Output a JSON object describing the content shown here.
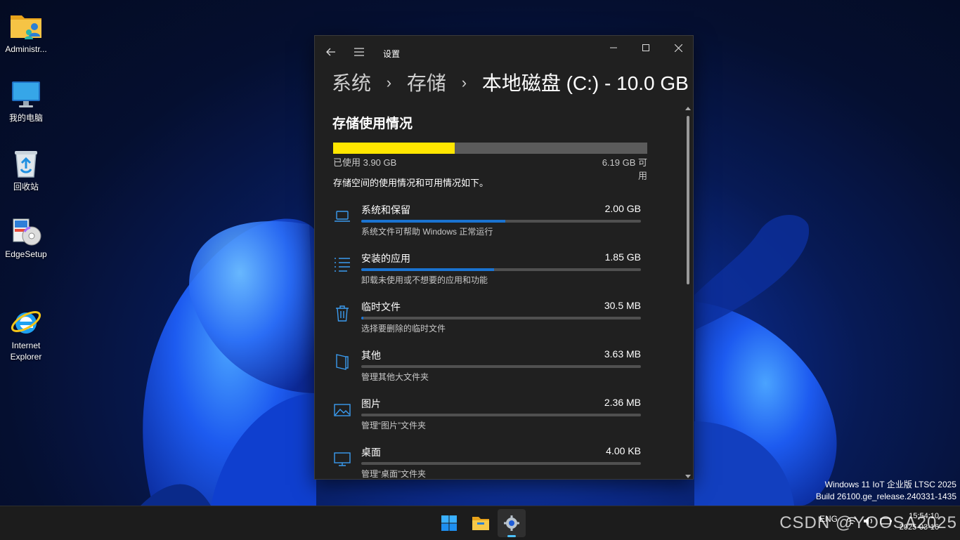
{
  "desktop": {
    "icons": [
      {
        "label": "Administr...",
        "icon": "user-folder-icon"
      },
      {
        "label": "我的电脑",
        "icon": "computer-icon"
      },
      {
        "label": "回收站",
        "icon": "recycle-bin-icon"
      },
      {
        "label": "EdgeSetup",
        "icon": "installer-icon"
      },
      {
        "label": "Internet\nExplorer",
        "icon": "internet-explorer-icon"
      }
    ]
  },
  "window": {
    "app_title": "设置",
    "breadcrumb": {
      "level1": "系统",
      "separator": "›",
      "level2": "存储",
      "current": "本地磁盘 (C:) - 10.0 GB"
    },
    "section_title": "存储使用情况",
    "usage": {
      "used_label": "已使用 3.90 GB",
      "free_label": "6.19 GB 可用",
      "used_fraction": 0.387,
      "bar_color": "#ffe600"
    },
    "description": "存储空间的使用情况和可用情况如下。",
    "categories": [
      {
        "name": "系统和保留",
        "size": "2.00 GB",
        "sub": "系统文件可帮助 Windows 正常运行",
        "fraction": 0.515,
        "icon": "laptop-icon"
      },
      {
        "name": "安装的应用",
        "size": "1.85 GB",
        "sub": "卸载未使用或不想要的应用和功能",
        "fraction": 0.475,
        "icon": "list-icon"
      },
      {
        "name": "临时文件",
        "size": "30.5 MB",
        "sub": "选择要删除的临时文件",
        "fraction": 0.008,
        "icon": "trash-icon"
      },
      {
        "name": "其他",
        "size": "3.63 MB",
        "sub": "管理其他大文件夹",
        "fraction": 0.0,
        "icon": "document-icon"
      },
      {
        "name": "图片",
        "size": "2.36 MB",
        "sub": "管理“图片”文件夹",
        "fraction": 0.0,
        "icon": "picture-icon"
      },
      {
        "name": "桌面",
        "size": "4.00 KB",
        "sub": "管理“桌面”文件夹",
        "fraction": 0.0,
        "icon": "monitor-icon"
      }
    ],
    "accent_color": "#1a73d1"
  },
  "watermark": {
    "line1": "Windows 11 IoT 企业版 LTSC 2025",
    "line2": "Build 26100.ge_release.240331-1435"
  },
  "taskbar": {
    "apps": [
      "start-icon",
      "file-explorer-icon",
      "settings-icon"
    ],
    "lang": "ENG",
    "time": "15:54:10",
    "date": "2025-03-16"
  },
  "overlay_text": "CSDN @YOOSA2025"
}
